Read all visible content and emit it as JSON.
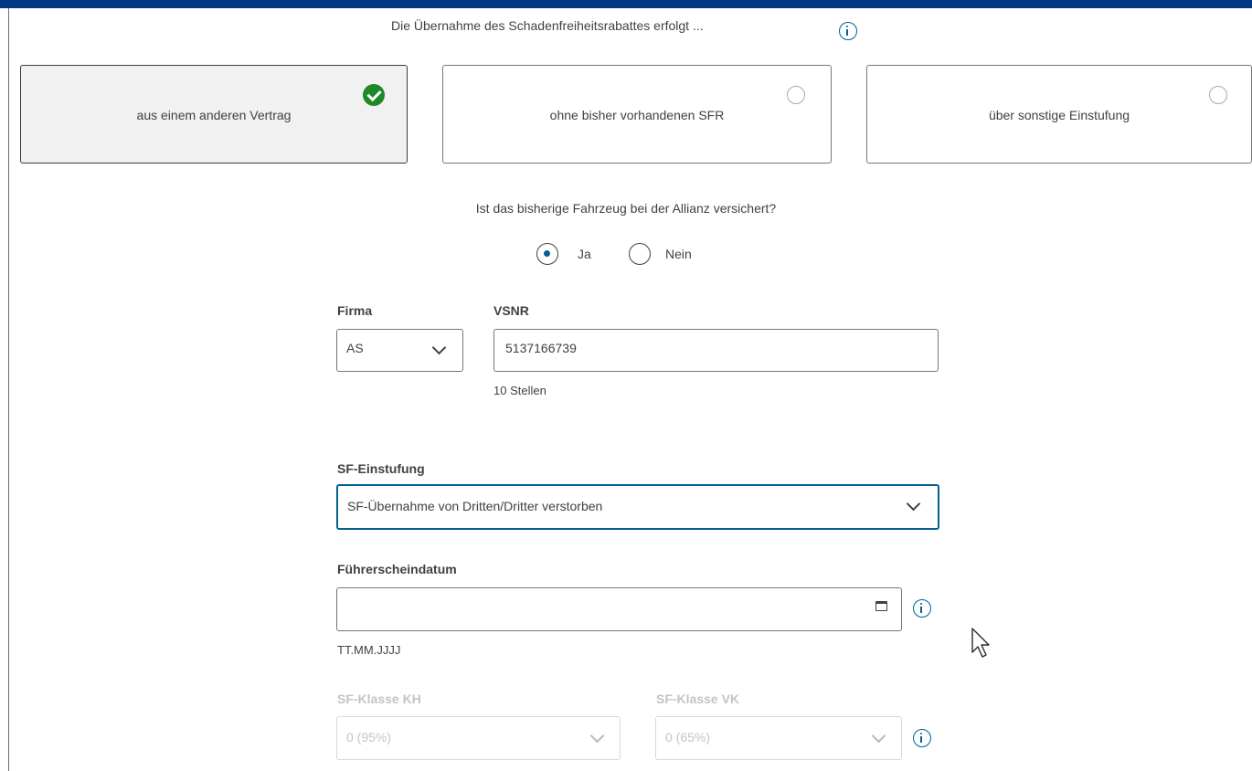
{
  "header": {
    "title": "Die Übernahme des Schadenfreiheitsrabattes erfolgt ..."
  },
  "options": [
    {
      "label": "aus einem anderen Vertrag",
      "selected": true
    },
    {
      "label": "ohne bisher vorhandenen SFR",
      "selected": false
    },
    {
      "label": "über sonstige Einstufung",
      "selected": false
    }
  ],
  "question": {
    "text": "Ist das bisherige Fahrzeug bei der Allianz versichert?",
    "yes_label": "Ja",
    "no_label": "Nein",
    "selected": "Ja"
  },
  "firma": {
    "label": "Firma",
    "value": "AS"
  },
  "vsnr": {
    "label": "VSNR",
    "value": "5137166739",
    "hint": "10 Stellen"
  },
  "sf_einstufung": {
    "label": "SF-Einstufung",
    "value": "SF-Übernahme von Dritten/Dritter verstorben"
  },
  "fuehrerscheindatum": {
    "label": "Führerscheindatum",
    "value": "",
    "hint": "TT.MM.JJJJ"
  },
  "sf_klasse_kh": {
    "label": "SF-Klasse KH",
    "value": "0 (95%)"
  },
  "sf_klasse_vk": {
    "label": "SF-Klasse VK",
    "value": "0 (65%)"
  },
  "colors": {
    "brand_header": "#003781",
    "accent": "#006192",
    "check_green": "#1e8927"
  }
}
